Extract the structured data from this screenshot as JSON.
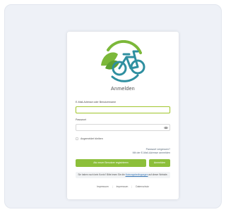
{
  "app": {
    "title": "Anmelden"
  },
  "form": {
    "username_label": "E-Mail-Adresse oder Benutzername",
    "username_value": "",
    "password_label": "Passwort",
    "password_value": "",
    "remember_label": "Angemeldet bleiben",
    "forgot_line1": "Passwort vergessen?",
    "forgot_line2": "Mit der E-Mail-Adresse anmelden",
    "register_button": "Als neuer Benutzer registrieren",
    "login_button": "Anmelden"
  },
  "notice": {
    "text_before": "Sie haben noch kein Konto? Bitte lesen Sie die ",
    "link": "Nutzungsbedingungen",
    "text_after": " auf dieser Website."
  },
  "footer": {
    "links": [
      "Impressum",
      "Impressum",
      "Datenschutz"
    ]
  },
  "colors": {
    "accent": "#8cbf3a",
    "logo_teal": "#2f8fa0",
    "logo_green": "#7cb83a"
  },
  "icons": {
    "logo": "bike-leaf-logo",
    "password_toggle": "eye-icon"
  }
}
